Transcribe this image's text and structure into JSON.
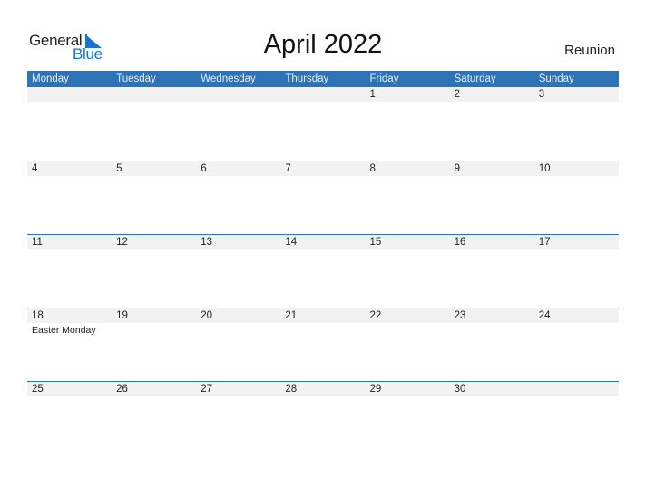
{
  "logo": {
    "general": "General",
    "blue": "Blue"
  },
  "title": "April 2022",
  "region": "Reunion",
  "accent_color": "#2e73b5",
  "weekdays": [
    "Monday",
    "Tuesday",
    "Wednesday",
    "Thursday",
    "Friday",
    "Saturday",
    "Sunday"
  ],
  "weeks": [
    {
      "days": [
        "",
        "",
        "",
        "",
        "1",
        "2",
        "3"
      ],
      "events": [
        "",
        "",
        "",
        "",
        "",
        "",
        ""
      ]
    },
    {
      "days": [
        "4",
        "5",
        "6",
        "7",
        "8",
        "9",
        "10"
      ],
      "events": [
        "",
        "",
        "",
        "",
        "",
        "",
        ""
      ]
    },
    {
      "days": [
        "11",
        "12",
        "13",
        "14",
        "15",
        "16",
        "17"
      ],
      "events": [
        "",
        "",
        "",
        "",
        "",
        "",
        ""
      ]
    },
    {
      "days": [
        "18",
        "19",
        "20",
        "21",
        "22",
        "23",
        "24"
      ],
      "events": [
        "Easter Monday",
        "",
        "",
        "",
        "",
        "",
        ""
      ]
    },
    {
      "days": [
        "25",
        "26",
        "27",
        "28",
        "29",
        "30",
        ""
      ],
      "events": [
        "",
        "",
        "",
        "",
        "",
        "",
        ""
      ]
    }
  ]
}
